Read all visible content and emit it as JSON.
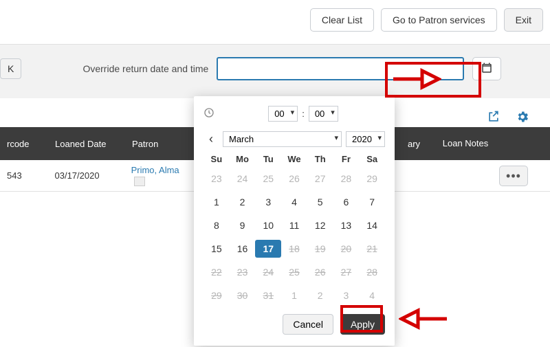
{
  "topbar": {
    "clear": "Clear List",
    "patron_services": "Go to Patron services",
    "exit": "Exit"
  },
  "override": {
    "ok": "K",
    "label": "Override return date and time",
    "date_value": ""
  },
  "table": {
    "headers": {
      "barcode": "rcode",
      "loaned": "Loaned Date",
      "patron": "Patron",
      "library": "ary",
      "notes": "Loan Notes"
    },
    "rows": [
      {
        "barcode": "543",
        "loaned": "03/17/2020",
        "patron": "Primo, Alma"
      }
    ],
    "more": "•••"
  },
  "datepicker": {
    "hour": "00",
    "minute": "00",
    "month": "March",
    "year": "2020",
    "dow": [
      "Su",
      "Mo",
      "Tu",
      "We",
      "Th",
      "Fr",
      "Sa"
    ],
    "weeks": [
      [
        {
          "d": "23",
          "cls": "muted"
        },
        {
          "d": "24",
          "cls": "muted"
        },
        {
          "d": "25",
          "cls": "muted"
        },
        {
          "d": "26",
          "cls": "muted"
        },
        {
          "d": "27",
          "cls": "muted"
        },
        {
          "d": "28",
          "cls": "muted"
        },
        {
          "d": "29",
          "cls": "muted"
        }
      ],
      [
        {
          "d": "1"
        },
        {
          "d": "2"
        },
        {
          "d": "3"
        },
        {
          "d": "4"
        },
        {
          "d": "5"
        },
        {
          "d": "6"
        },
        {
          "d": "7"
        }
      ],
      [
        {
          "d": "8"
        },
        {
          "d": "9"
        },
        {
          "d": "10"
        },
        {
          "d": "11"
        },
        {
          "d": "12"
        },
        {
          "d": "13"
        },
        {
          "d": "14"
        }
      ],
      [
        {
          "d": "15"
        },
        {
          "d": "16"
        },
        {
          "d": "17",
          "cls": "selected"
        },
        {
          "d": "18",
          "cls": "strike"
        },
        {
          "d": "19",
          "cls": "strike"
        },
        {
          "d": "20",
          "cls": "strike"
        },
        {
          "d": "21",
          "cls": "strike"
        }
      ],
      [
        {
          "d": "22",
          "cls": "strike"
        },
        {
          "d": "23",
          "cls": "strike"
        },
        {
          "d": "24",
          "cls": "strike"
        },
        {
          "d": "25",
          "cls": "strike"
        },
        {
          "d": "26",
          "cls": "strike"
        },
        {
          "d": "27",
          "cls": "strike"
        },
        {
          "d": "28",
          "cls": "strike"
        }
      ],
      [
        {
          "d": "29",
          "cls": "strike"
        },
        {
          "d": "30",
          "cls": "strike"
        },
        {
          "d": "31",
          "cls": "strike"
        },
        {
          "d": "1",
          "cls": "muted"
        },
        {
          "d": "2",
          "cls": "muted"
        },
        {
          "d": "3",
          "cls": "muted"
        },
        {
          "d": "4",
          "cls": "muted"
        }
      ]
    ],
    "cancel": "Cancel",
    "apply": "Apply"
  }
}
